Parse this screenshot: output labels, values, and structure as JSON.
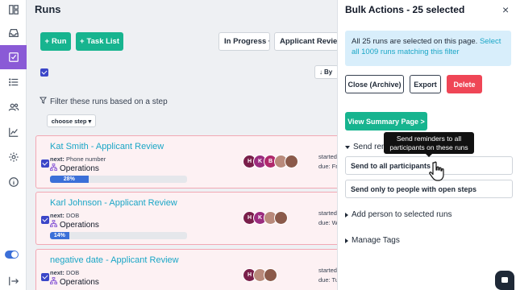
{
  "page": {
    "title": "Runs"
  },
  "toolbar": {
    "run_label": "Run",
    "task_list_label": "Task List",
    "status_filter": "In Progress",
    "template_filter": "Applicant Review",
    "sort_label": "By"
  },
  "filter": {
    "label": "Filter these runs based on a step",
    "choose_step": "choose step"
  },
  "runs": [
    {
      "title": "Kat Smith - Applicant Review",
      "next_label": "next:",
      "next_step": "Phone number",
      "team": "Operations",
      "progress": 28,
      "progress_label": "28%",
      "started": "started",
      "due": "due: Fri"
    },
    {
      "title": "Karl Johnson - Applicant Review",
      "next_label": "next:",
      "next_step": "DOB",
      "team": "Operations",
      "progress": 14,
      "progress_label": "14%",
      "started": "started",
      "due": "due: W"
    },
    {
      "title": "negative date - Applicant Review",
      "next_label": "next:",
      "next_step": "DOB",
      "team": "Operations",
      "progress": 0,
      "progress_label": "",
      "started": "started",
      "due": "due: Tu"
    }
  ],
  "avatars_1": [
    {
      "initial": "H",
      "color": "#7a1f4a"
    },
    {
      "initial": "K",
      "color": "#9b2d7f"
    },
    {
      "initial": "B",
      "color": "#b02a6c"
    },
    {
      "initial": "",
      "color": "#b98a7b"
    },
    {
      "initial": "",
      "color": "#8b5a4a"
    }
  ],
  "avatars_2": [
    {
      "initial": "H",
      "color": "#7a1f4a"
    },
    {
      "initial": "K",
      "color": "#9b2d7f"
    },
    {
      "initial": "",
      "color": "#b98a7b"
    },
    {
      "initial": "",
      "color": "#8b5a4a"
    }
  ],
  "avatars_3": [
    {
      "initial": "H",
      "color": "#7a1f4a"
    },
    {
      "initial": "",
      "color": "#b98a7b"
    },
    {
      "initial": "",
      "color": "#8b5a4a"
    }
  ],
  "panel": {
    "title": "Bulk Actions - 25 selected",
    "close_icon": "×",
    "info_text": "All 25 runs are selected on this page.",
    "info_link": "Select all 1009 runs matching this filter",
    "close_archive": "Close (Archive)",
    "export": "Export",
    "delete": "Delete",
    "summary": "View Summary Page >",
    "send_reminders": "Send reminders",
    "send_all": "Send to all participants",
    "send_open": "Send only to people with open steps",
    "add_person": "Add person to selected runs",
    "manage_tags": "Manage Tags"
  },
  "tooltip": {
    "text": "Send reminders to all participants on these runs"
  },
  "colors": {
    "accent": "#17b48f",
    "primary": "#3b46c8",
    "danger": "#ef4656",
    "link": "#1aa6c6",
    "rail_active": "#8a5ad6"
  },
  "icons": [
    "layout-icon",
    "inbox-icon",
    "checklist-icon",
    "list-icon",
    "people-icon",
    "chart-icon",
    "gear-icon",
    "info-icon",
    "logout-icon"
  ]
}
